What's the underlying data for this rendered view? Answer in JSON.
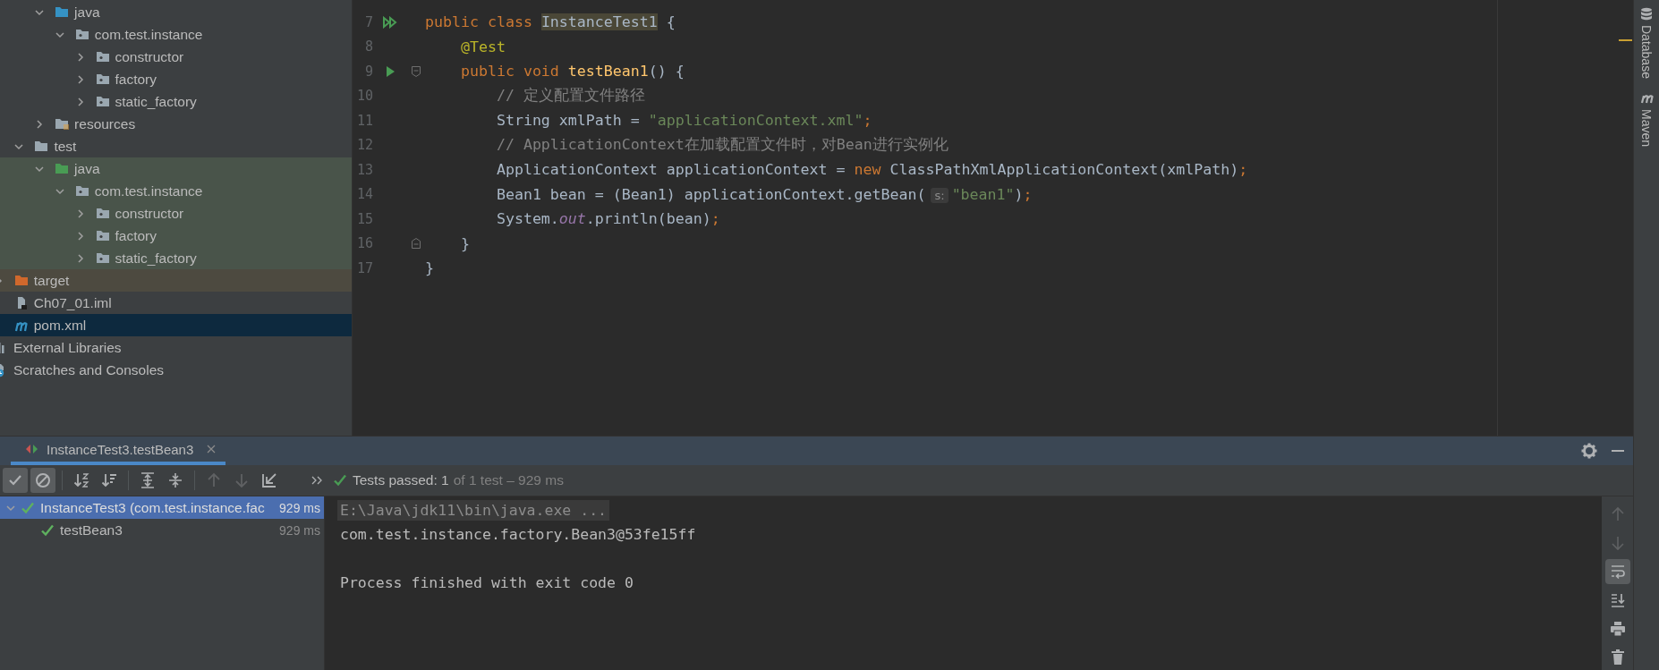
{
  "project_tree": {
    "items": [
      {
        "children": [
          {
            "children": [
              {
                "children": [
                  {
                    "label": "java",
                    "kind": "source-root",
                    "expanded": true,
                    "selected": false,
                    "children": [
                      {
                        "label": "com.test.instance",
                        "kind": "package",
                        "expanded": true,
                        "selected": false,
                        "children": [
                          {
                            "label": "constructor",
                            "kind": "package",
                            "expanded": false,
                            "selected": false
                          },
                          {
                            "label": "factory",
                            "kind": "package",
                            "expanded": false,
                            "selected": false
                          },
                          {
                            "label": "static_factory",
                            "kind": "package",
                            "expanded": false,
                            "selected": false
                          }
                        ]
                      }
                    ]
                  },
                  {
                    "label": "resources",
                    "kind": "resource-root",
                    "expanded": false,
                    "selected": false
                  }
                ]
              },
              {
                "label": "test",
                "kind": "folder",
                "expanded": true,
                "selected": false,
                "children": [
                  {
                    "label": "java",
                    "kind": "test-root",
                    "expanded": true,
                    "selected": false,
                    "children": [
                      {
                        "label": "com.test.instance",
                        "kind": "package",
                        "expanded": true,
                        "selected": false,
                        "children": [
                          {
                            "label": "constructor",
                            "kind": "package",
                            "expanded": false,
                            "selected": false
                          },
                          {
                            "label": "factory",
                            "kind": "package",
                            "expanded": false,
                            "selected": false
                          },
                          {
                            "label": "static_factory",
                            "kind": "package",
                            "expanded": false,
                            "selected": false
                          }
                        ]
                      }
                    ]
                  }
                ]
              }
            ]
          },
          {
            "label": "target",
            "kind": "excluded",
            "expanded": false,
            "selected": false
          },
          {
            "label": "Ch07_01.iml",
            "kind": "module-file",
            "selected": false
          },
          {
            "label": "pom.xml",
            "kind": "maven-file",
            "selected": true
          }
        ]
      },
      {
        "label": "External Libraries",
        "kind": "libraries",
        "selected": false
      },
      {
        "label": "Scratches and Consoles",
        "kind": "scratches",
        "selected": false
      }
    ]
  },
  "editor": {
    "lines": [
      {
        "number": "7",
        "marks": [
          {
            "kind": "run-all"
          }
        ],
        "tokens": [
          {
            "text": "public class ",
            "kind": "keyword"
          },
          {
            "text": "InstanceTest1",
            "kind": "class-highlight"
          },
          {
            "text": " {",
            "kind": "plain"
          }
        ]
      },
      {
        "number": "8",
        "tokens": [
          {
            "text": "    @Test",
            "kind": "annotation"
          }
        ]
      },
      {
        "number": "9",
        "marks": [
          {
            "kind": "run"
          },
          {
            "kind": "fold-start"
          }
        ],
        "tokens": [
          {
            "text": "    public void ",
            "kind": "keyword"
          },
          {
            "text": "testBean1",
            "kind": "method"
          },
          {
            "text": "() {",
            "kind": "plain"
          }
        ]
      },
      {
        "number": "10",
        "tokens": [
          {
            "text": "        // 定义配置文件路径",
            "kind": "comment"
          }
        ]
      },
      {
        "number": "11",
        "tokens": [
          {
            "text": "        String xmlPath = ",
            "kind": "plain"
          },
          {
            "text": "\"applicationContext.xml\"",
            "kind": "string"
          },
          {
            "text": ";",
            "kind": "keyword"
          }
        ]
      },
      {
        "number": "12",
        "tokens": [
          {
            "text": "        // ApplicationContext在加载配置文件时，对Bean进行实例化",
            "kind": "comment"
          }
        ]
      },
      {
        "number": "13",
        "tokens": [
          {
            "text": "        ApplicationContext applicationContext = ",
            "kind": "plain"
          },
          {
            "text": "new",
            "kind": "keyword"
          },
          {
            "text": " ClassPathXmlApplicationContext(xmlPath)",
            "kind": "plain"
          },
          {
            "text": ";",
            "kind": "keyword"
          }
        ]
      },
      {
        "number": "14",
        "tokens": [
          {
            "text": "        Bean1 bean = (Bean1) applicationContext.getBean(",
            "kind": "plain"
          },
          {
            "text": "s:",
            "kind": "hint"
          },
          {
            "text": "\"bean1\"",
            "kind": "string"
          },
          {
            "text": ")",
            "kind": "plain"
          },
          {
            "text": ";",
            "kind": "keyword"
          }
        ]
      },
      {
        "number": "15",
        "tokens": [
          {
            "text": "        System.",
            "kind": "plain"
          },
          {
            "text": "out",
            "kind": "static-field"
          },
          {
            "text": ".println(bean)",
            "kind": "plain"
          },
          {
            "text": ";",
            "kind": "keyword"
          }
        ]
      },
      {
        "number": "16",
        "marks": [
          {
            "kind": "fold-end"
          }
        ],
        "tokens": [
          {
            "text": "    }",
            "kind": "plain"
          }
        ]
      },
      {
        "number": "17",
        "tokens": [
          {
            "text": "}",
            "kind": "plain"
          }
        ]
      }
    ]
  },
  "right_sidebar": {
    "tools": [
      {
        "label": "Database",
        "kind": "database"
      },
      {
        "label": "Maven",
        "kind": "maven"
      }
    ]
  },
  "run_panel": {
    "tabs": [
      {
        "label": "InstanceTest3.testBean3",
        "selected": true
      }
    ],
    "toolbar": [
      {
        "kind": "show-passed",
        "on": true
      },
      {
        "kind": "show-ignored",
        "on": true
      },
      {
        "kind": "sort-alpha",
        "disabled": false
      },
      {
        "kind": "sort-duration",
        "disabled": false
      },
      {
        "kind": "expand-all",
        "disabled": false
      },
      {
        "kind": "collapse-all",
        "disabled": false
      },
      {
        "kind": "previous",
        "disabled": true
      },
      {
        "kind": "next",
        "disabled": true
      },
      {
        "kind": "import",
        "disabled": false
      }
    ],
    "status": {
      "label": "Tests passed: 1",
      "detail": "of 1 test – 929 ms"
    },
    "test_tree": [
      {
        "label": "InstanceTest3 (com.test.instance.fac",
        "time": "929 ms",
        "expanded": true,
        "selected": true,
        "children": [
          {
            "label": "testBean3",
            "time": "929 ms",
            "selected": false
          }
        ]
      }
    ],
    "console": [
      {
        "kind": "command",
        "text": "E:\\Java\\jdk11\\bin\\java.exe ..."
      },
      {
        "kind": "output",
        "text": "com.test.instance.factory.Bean3@53fe15ff"
      },
      {
        "kind": "blank"
      },
      {
        "kind": "output",
        "text": "Process finished with exit code 0"
      }
    ],
    "console_toolbar": [
      {
        "kind": "up",
        "disabled": true
      },
      {
        "kind": "down",
        "disabled": true
      },
      {
        "kind": "soft-wrap",
        "on": true
      },
      {
        "kind": "scroll-end",
        "on": false
      },
      {
        "kind": "print",
        "disabled": false
      },
      {
        "kind": "clear",
        "disabled": false
      }
    ]
  }
}
